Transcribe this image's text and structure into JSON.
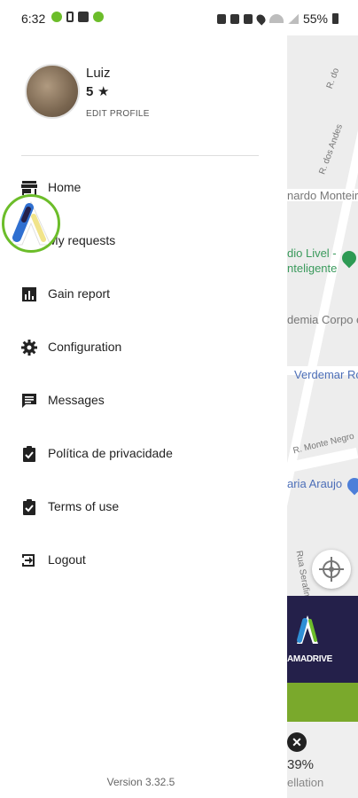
{
  "status_bar": {
    "time": "6:32",
    "battery": "55%"
  },
  "map": {
    "labels": [
      "R. do",
      "R. dos Andes",
      "nardo Monteiro",
      "dio Livel -",
      "nteligente",
      "demia Corpo e",
      "Verdemar Ro",
      "R. Monte Negro",
      "aria Araujo",
      "Rua Serafim"
    ]
  },
  "drawer": {
    "profile": {
      "name": "Luiz",
      "rating": "5",
      "edit_label": "EDIT PROFILE"
    },
    "menu": [
      {
        "label": "Home",
        "icon": "store-icon"
      },
      {
        "label": "My requests",
        "icon": "list-icon"
      },
      {
        "label": "Gain report",
        "icon": "bar-chart-icon"
      },
      {
        "label": "Configuration",
        "icon": "gear-icon"
      },
      {
        "label": "Messages",
        "icon": "chat-icon"
      },
      {
        "label": "Política de privacidade",
        "icon": "clipboard-check-icon"
      },
      {
        "label": "Terms of use",
        "icon": "clipboard-check-icon"
      },
      {
        "label": "Logout",
        "icon": "logout-icon"
      }
    ],
    "version": "Version 3.32.5"
  },
  "brand": {
    "name": "AMADRIVE"
  },
  "stats": {
    "cancellation_pct": "39%",
    "cancellation_label": "ellation"
  },
  "colors": {
    "brand_green": "#6cbd2a",
    "brand_dark": "#24204a",
    "bar_green": "#7aa92c"
  }
}
